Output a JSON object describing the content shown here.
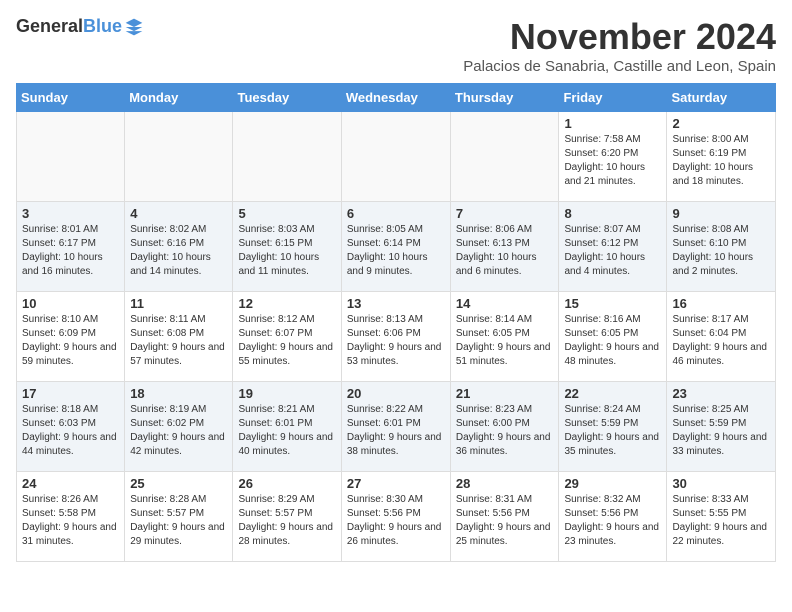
{
  "logo": {
    "general": "General",
    "blue": "Blue"
  },
  "header": {
    "month": "November 2024",
    "location": "Palacios de Sanabria, Castille and Leon, Spain"
  },
  "weekdays": [
    "Sunday",
    "Monday",
    "Tuesday",
    "Wednesday",
    "Thursday",
    "Friday",
    "Saturday"
  ],
  "weeks": [
    [
      {
        "day": "",
        "info": ""
      },
      {
        "day": "",
        "info": ""
      },
      {
        "day": "",
        "info": ""
      },
      {
        "day": "",
        "info": ""
      },
      {
        "day": "",
        "info": ""
      },
      {
        "day": "1",
        "info": "Sunrise: 7:58 AM\nSunset: 6:20 PM\nDaylight: 10 hours and 21 minutes."
      },
      {
        "day": "2",
        "info": "Sunrise: 8:00 AM\nSunset: 6:19 PM\nDaylight: 10 hours and 18 minutes."
      }
    ],
    [
      {
        "day": "3",
        "info": "Sunrise: 8:01 AM\nSunset: 6:17 PM\nDaylight: 10 hours and 16 minutes."
      },
      {
        "day": "4",
        "info": "Sunrise: 8:02 AM\nSunset: 6:16 PM\nDaylight: 10 hours and 14 minutes."
      },
      {
        "day": "5",
        "info": "Sunrise: 8:03 AM\nSunset: 6:15 PM\nDaylight: 10 hours and 11 minutes."
      },
      {
        "day": "6",
        "info": "Sunrise: 8:05 AM\nSunset: 6:14 PM\nDaylight: 10 hours and 9 minutes."
      },
      {
        "day": "7",
        "info": "Sunrise: 8:06 AM\nSunset: 6:13 PM\nDaylight: 10 hours and 6 minutes."
      },
      {
        "day": "8",
        "info": "Sunrise: 8:07 AM\nSunset: 6:12 PM\nDaylight: 10 hours and 4 minutes."
      },
      {
        "day": "9",
        "info": "Sunrise: 8:08 AM\nSunset: 6:10 PM\nDaylight: 10 hours and 2 minutes."
      }
    ],
    [
      {
        "day": "10",
        "info": "Sunrise: 8:10 AM\nSunset: 6:09 PM\nDaylight: 9 hours and 59 minutes."
      },
      {
        "day": "11",
        "info": "Sunrise: 8:11 AM\nSunset: 6:08 PM\nDaylight: 9 hours and 57 minutes."
      },
      {
        "day": "12",
        "info": "Sunrise: 8:12 AM\nSunset: 6:07 PM\nDaylight: 9 hours and 55 minutes."
      },
      {
        "day": "13",
        "info": "Sunrise: 8:13 AM\nSunset: 6:06 PM\nDaylight: 9 hours and 53 minutes."
      },
      {
        "day": "14",
        "info": "Sunrise: 8:14 AM\nSunset: 6:05 PM\nDaylight: 9 hours and 51 minutes."
      },
      {
        "day": "15",
        "info": "Sunrise: 8:16 AM\nSunset: 6:05 PM\nDaylight: 9 hours and 48 minutes."
      },
      {
        "day": "16",
        "info": "Sunrise: 8:17 AM\nSunset: 6:04 PM\nDaylight: 9 hours and 46 minutes."
      }
    ],
    [
      {
        "day": "17",
        "info": "Sunrise: 8:18 AM\nSunset: 6:03 PM\nDaylight: 9 hours and 44 minutes."
      },
      {
        "day": "18",
        "info": "Sunrise: 8:19 AM\nSunset: 6:02 PM\nDaylight: 9 hours and 42 minutes."
      },
      {
        "day": "19",
        "info": "Sunrise: 8:21 AM\nSunset: 6:01 PM\nDaylight: 9 hours and 40 minutes."
      },
      {
        "day": "20",
        "info": "Sunrise: 8:22 AM\nSunset: 6:01 PM\nDaylight: 9 hours and 38 minutes."
      },
      {
        "day": "21",
        "info": "Sunrise: 8:23 AM\nSunset: 6:00 PM\nDaylight: 9 hours and 36 minutes."
      },
      {
        "day": "22",
        "info": "Sunrise: 8:24 AM\nSunset: 5:59 PM\nDaylight: 9 hours and 35 minutes."
      },
      {
        "day": "23",
        "info": "Sunrise: 8:25 AM\nSunset: 5:59 PM\nDaylight: 9 hours and 33 minutes."
      }
    ],
    [
      {
        "day": "24",
        "info": "Sunrise: 8:26 AM\nSunset: 5:58 PM\nDaylight: 9 hours and 31 minutes."
      },
      {
        "day": "25",
        "info": "Sunrise: 8:28 AM\nSunset: 5:57 PM\nDaylight: 9 hours and 29 minutes."
      },
      {
        "day": "26",
        "info": "Sunrise: 8:29 AM\nSunset: 5:57 PM\nDaylight: 9 hours and 28 minutes."
      },
      {
        "day": "27",
        "info": "Sunrise: 8:30 AM\nSunset: 5:56 PM\nDaylight: 9 hours and 26 minutes."
      },
      {
        "day": "28",
        "info": "Sunrise: 8:31 AM\nSunset: 5:56 PM\nDaylight: 9 hours and 25 minutes."
      },
      {
        "day": "29",
        "info": "Sunrise: 8:32 AM\nSunset: 5:56 PM\nDaylight: 9 hours and 23 minutes."
      },
      {
        "day": "30",
        "info": "Sunrise: 8:33 AM\nSunset: 5:55 PM\nDaylight: 9 hours and 22 minutes."
      }
    ]
  ]
}
